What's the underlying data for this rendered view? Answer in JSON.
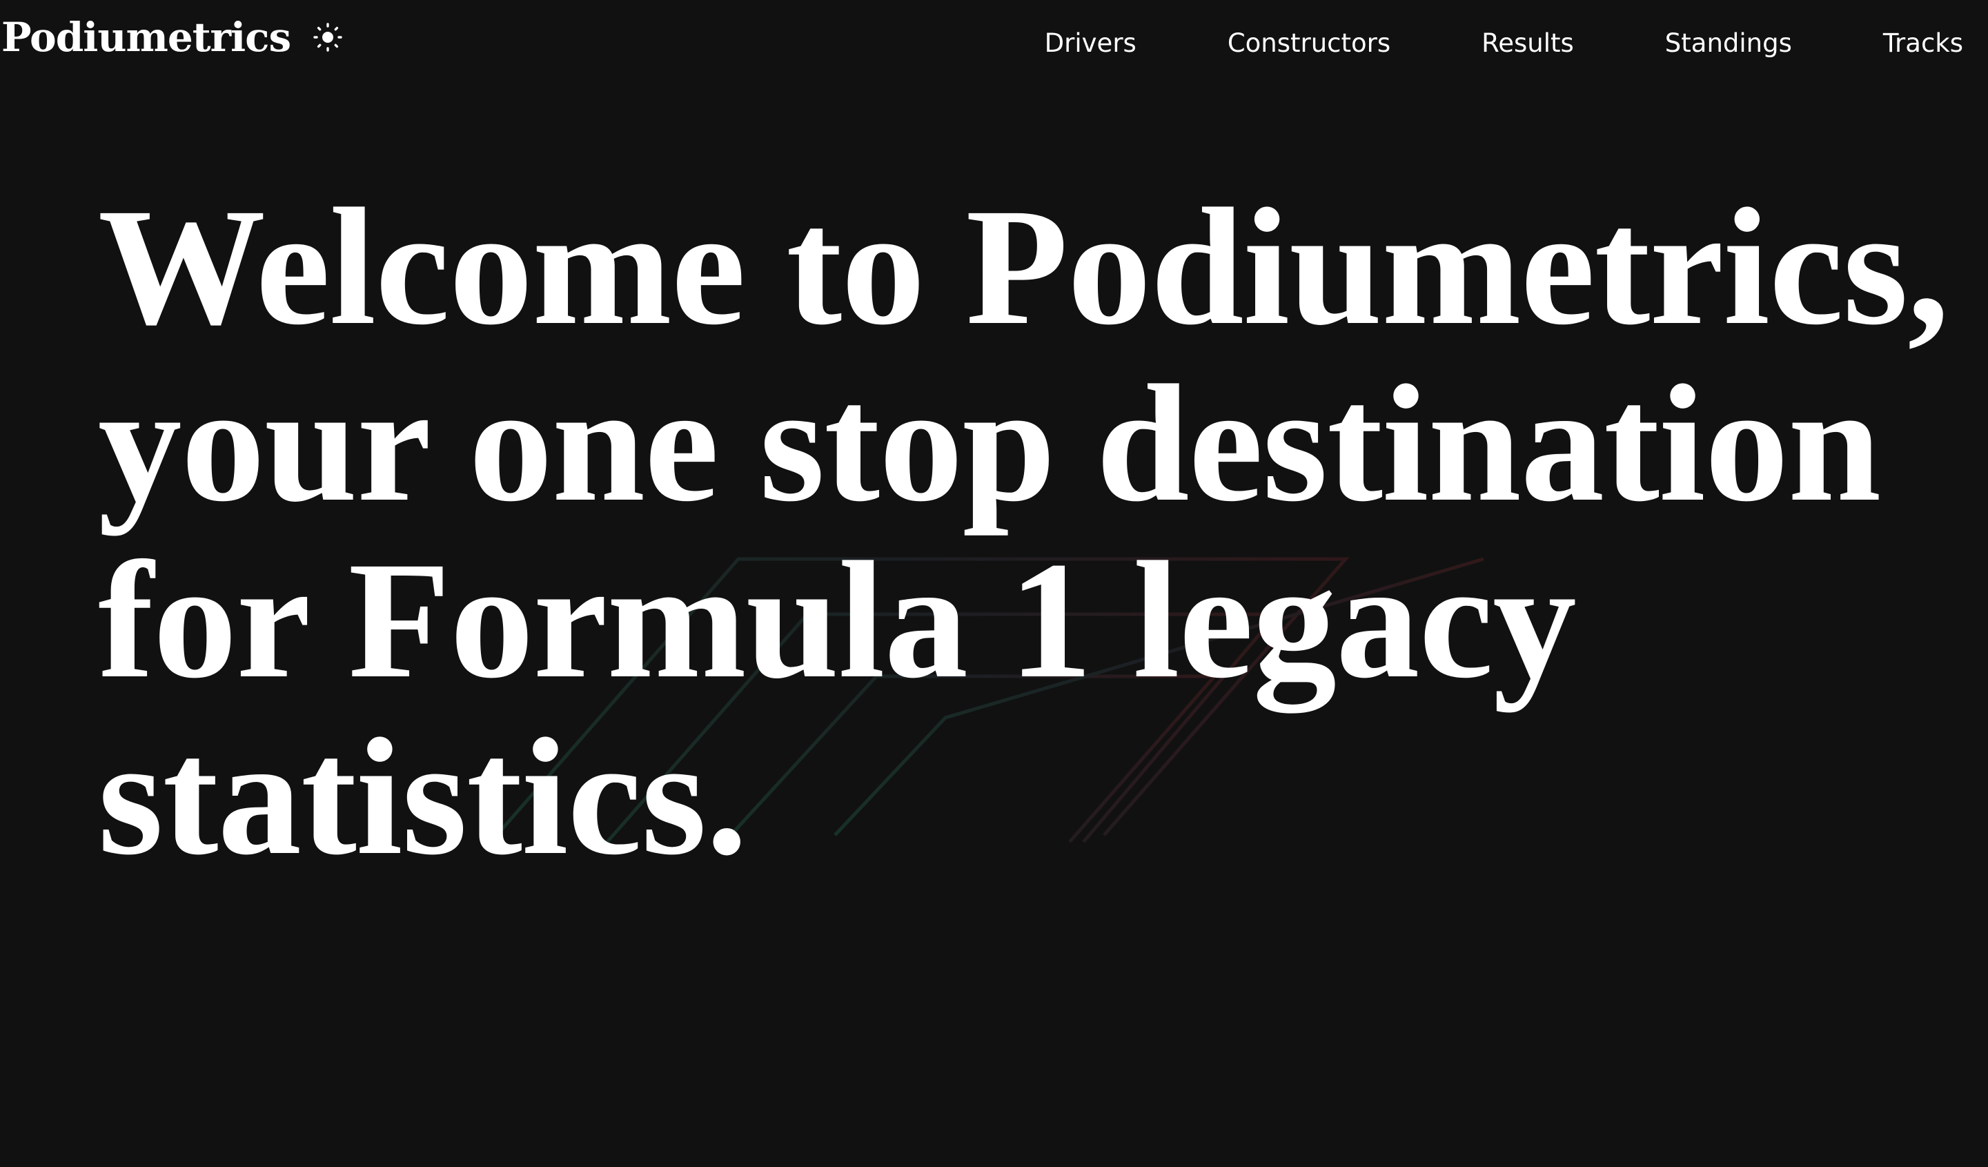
{
  "app": {
    "brand_name": "Podiumetrics",
    "theme_toggle_icon": "sun-icon"
  },
  "nav": {
    "items": [
      {
        "label": "Drivers"
      },
      {
        "label": "Constructors"
      },
      {
        "label": "Results"
      },
      {
        "label": "Standings"
      },
      {
        "label": "Tracks"
      }
    ]
  },
  "hero": {
    "title": "Welcome to Podiumetrics, your one stop destination for Formula 1 legacy statistics."
  },
  "colors": {
    "background": "#111111",
    "text": "#ffffff",
    "logo_stripe_green": "#1f4a3a",
    "logo_stripe_red": "#4a1f22"
  }
}
